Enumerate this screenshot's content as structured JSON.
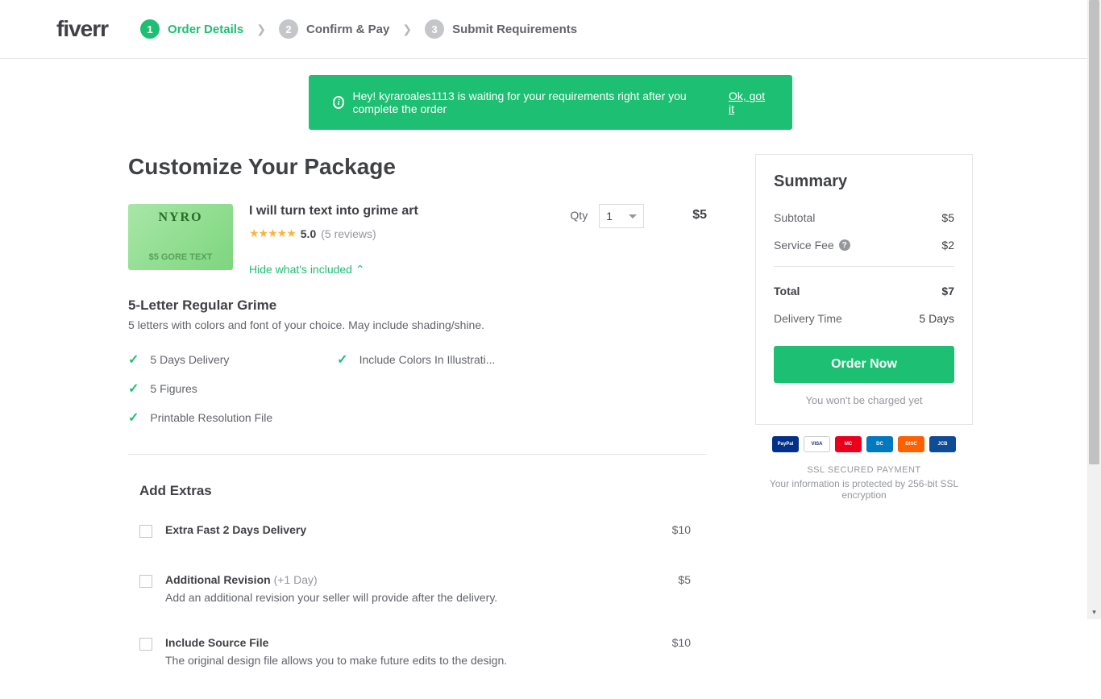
{
  "logo": "fiverr",
  "steps": [
    {
      "num": "1",
      "label": "Order Details",
      "active": true
    },
    {
      "num": "2",
      "label": "Confirm & Pay",
      "active": false
    },
    {
      "num": "3",
      "label": "Submit Requirements",
      "active": false
    }
  ],
  "banner": {
    "message": "Hey! kyraroales1113 is waiting for your requirements right after you complete the order",
    "cta": "Ok, got it"
  },
  "page_title": "Customize Your Package",
  "gig": {
    "title": "I will turn text into grime art",
    "rating": "5.0",
    "review_count": "(5 reviews)",
    "toggle": "Hide what's included",
    "qty_label": "Qty",
    "qty_value": "1",
    "price": "$5"
  },
  "package": {
    "name": "5-Letter Regular Grime",
    "desc": "5 letters with colors and font of your choice. May include shading/shine."
  },
  "features": {
    "col1": [
      "5 Days Delivery",
      "5 Figures",
      "Printable Resolution File"
    ],
    "col2": [
      "Include Colors In Illustrati..."
    ]
  },
  "extras_title": "Add Extras",
  "extras": [
    {
      "name": "Extra Fast 2 Days Delivery",
      "meta": "",
      "desc": "",
      "price": "$10"
    },
    {
      "name": "Additional Revision",
      "meta": " (+1 Day)",
      "desc": "Add an additional revision your seller will provide after the delivery.",
      "price": "$5"
    },
    {
      "name": "Include Source File",
      "meta": "",
      "desc": "The original design file allows you to make future edits to the design.",
      "price": "$10"
    }
  ],
  "summary": {
    "title": "Summary",
    "subtotal_label": "Subtotal",
    "subtotal": "$5",
    "fee_label": "Service Fee",
    "fee": "$2",
    "total_label": "Total",
    "total": "$7",
    "delivery_label": "Delivery Time",
    "delivery": "5 Days",
    "button": "Order Now",
    "note": "You won't be charged yet"
  },
  "payment_badges": [
    "PayPal",
    "VISA",
    "MC",
    "DC",
    "DISC",
    "JCB"
  ],
  "ssl": {
    "title": "SSL SECURED PAYMENT",
    "desc": "Your information is protected by 256-bit SSL encryption"
  }
}
